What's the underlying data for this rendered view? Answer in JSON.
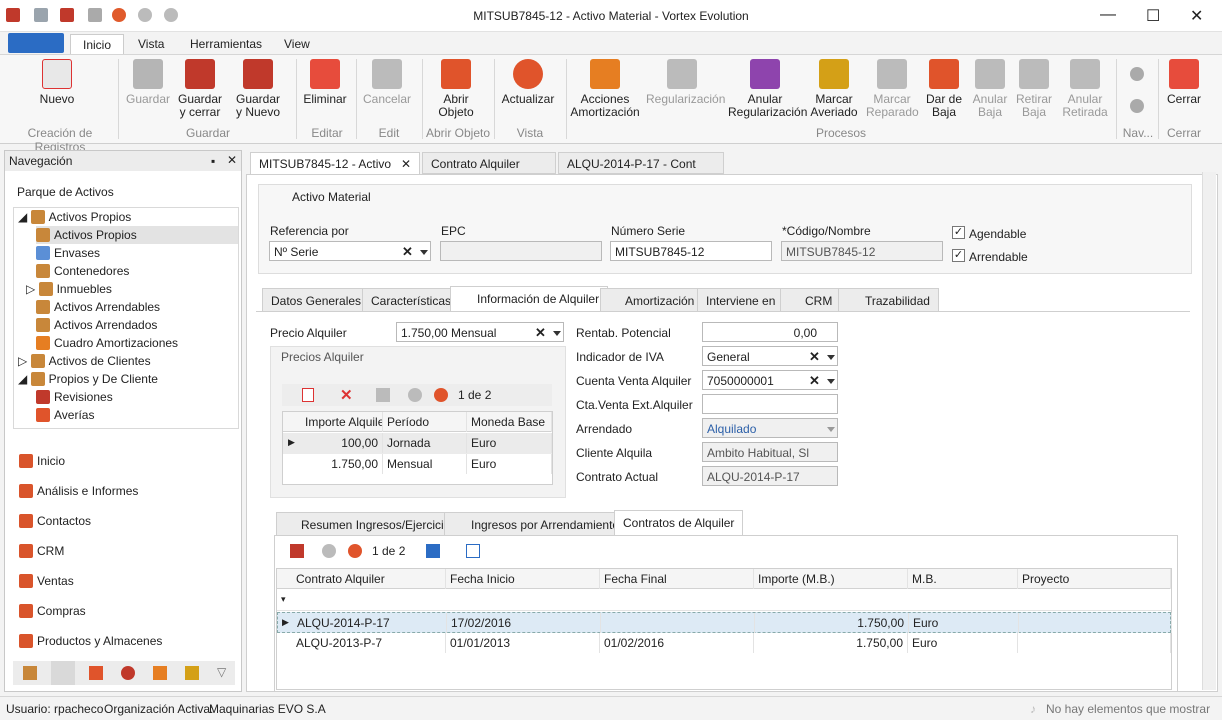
{
  "window": {
    "title": "MITSUB7845-12 - Activo Material - Vortex Evolution"
  },
  "menu": {
    "tabs": [
      "Inicio",
      "Vista",
      "Herramientas",
      "View"
    ]
  },
  "ribbon": {
    "buttons": [
      "Nuevo",
      "Guardar",
      "Guardar\ny cerrar",
      "Guardar\ny Nuevo",
      "Eliminar",
      "Cancelar",
      "Abrir\nObjeto",
      "Actualizar",
      "Acciones\nAmortización",
      "Regularización",
      "Anular\nRegularización",
      "Marcar\nAveriado",
      "Marcar\nReparado",
      "Dar de\nBaja",
      "Anular\nBaja",
      "Retirar\nBaja",
      "Anular\nRetirada",
      "Cerrar"
    ],
    "groups": [
      "Creación de Registros",
      "Guardar",
      "Editar",
      "Edit",
      "Abrir Objeto",
      "Vista",
      "Procesos",
      "Nav...",
      "Cerrar"
    ]
  },
  "nav": {
    "title": "Navegación",
    "section": "Parque de Activos",
    "tree": [
      "Activos Propios",
      "Activos Propios",
      "Envases",
      "Contenedores",
      "Inmuebles",
      "Activos Arrendables",
      "Activos Arrendados",
      "Cuadro Amortizaciones",
      "Activos de Clientes",
      "Propios y De Cliente",
      "Revisiones",
      "Averías"
    ],
    "buttons": [
      "Inicio",
      "Análisis e Informes",
      "Contactos",
      "CRM",
      "Ventas",
      "Compras",
      "Productos y Almacenes"
    ]
  },
  "doc_tabs": [
    "MITSUB7845-12 - Activo",
    "Contrato Alquiler",
    "ALQU-2014-P-17 - Cont"
  ],
  "header": {
    "title": "Activo Material",
    "ref_label": "Referencia por",
    "ref_value": "Nº Serie",
    "epc_label": "EPC",
    "serie_label": "Número Serie",
    "serie_value": "MITSUB7845-12",
    "code_label": "*Código/Nombre",
    "code_value": "MITSUB7845-12",
    "agendable": "Agendable",
    "arrendable": "Arrendable"
  },
  "tabs": [
    "Datos Generales",
    "Características",
    "Información de Alquiler",
    "Amortización",
    "Interviene en",
    "CRM",
    "Trazabilidad"
  ],
  "alquiler": {
    "precio_label": "Precio Alquiler",
    "precio_value": "1.750,00 Mensual",
    "precios_title": "Precios Alquiler",
    "pager": "1 de 2",
    "cols": [
      "Importe Alquiler",
      "Período",
      "Moneda Base"
    ],
    "rows": [
      [
        "100,00",
        "Jornada",
        "Euro"
      ],
      [
        "1.750,00",
        "Mensual",
        "Euro"
      ]
    ],
    "right": [
      [
        "Rentab. Potencial",
        "0,00"
      ],
      [
        "Indicador de IVA",
        "General"
      ],
      [
        "Cuenta Venta Alquiler",
        "7050000001"
      ],
      [
        "Cta.Venta Ext.Alquiler",
        ""
      ],
      [
        "Arrendado",
        "Alquilado"
      ],
      [
        "Cliente Alquila",
        "Ambito Habitual, Sl"
      ],
      [
        "Contrato Actual",
        "ALQU-2014-P-17"
      ]
    ]
  },
  "lower": {
    "tabs": [
      "Resumen Ingresos/Ejercicio",
      "Ingresos por Arrendamiento",
      "Contratos de Alquiler"
    ],
    "pager": "1 de 2",
    "cols": [
      "Contrato Alquiler",
      "Fecha Inicio",
      "Fecha Final",
      "Importe (M.B.)",
      "M.B.",
      "Proyecto"
    ],
    "rows": [
      [
        "ALQU-2014-P-17",
        "17/02/2016",
        "",
        "1.750,00",
        "Euro",
        ""
      ],
      [
        "ALQU-2013-P-7",
        "01/01/2013",
        "01/02/2016",
        "1.750,00",
        "Euro",
        ""
      ]
    ]
  },
  "status": {
    "user": "Usuario: rpacheco",
    "org": "Organización Activa:",
    "org_value": "Maquinarias EVO S.A",
    "msg": "No hay elementos que mostrar"
  }
}
